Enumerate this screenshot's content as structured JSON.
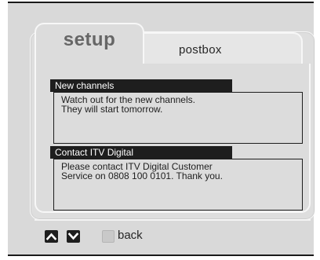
{
  "tabs": {
    "active": "setup",
    "inactive": "postbox"
  },
  "messages": [
    {
      "title": "New channels",
      "lines": [
        "Watch out for the new channels.",
        "They will start tomorrow."
      ]
    },
    {
      "title": "Contact ITV Digital",
      "lines": [
        "Please contact ITV Digital Customer",
        "Service on 0808 100 0101. Thank you."
      ]
    }
  ],
  "footer": {
    "up_icon": "chevron-up-icon",
    "down_icon": "chevron-down-icon",
    "back_label": "back"
  },
  "colors": {
    "background": "#d9d9d9",
    "header": "#1e1e1e",
    "header_text": "#ffffff",
    "tab_label_active": "#666666"
  }
}
